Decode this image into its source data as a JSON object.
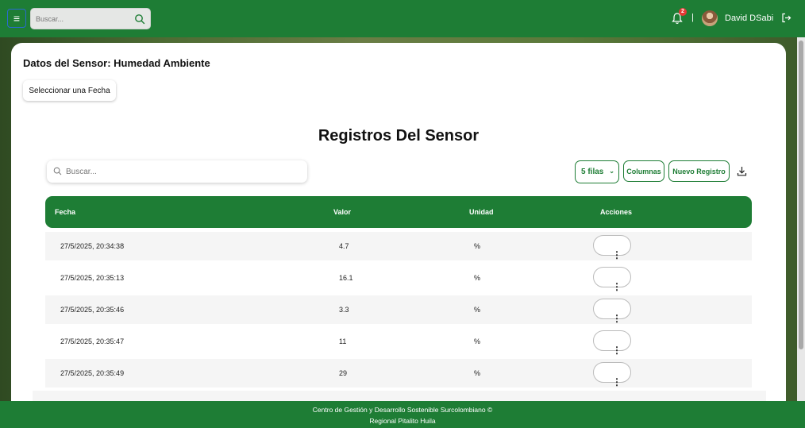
{
  "topbar": {
    "menu_icon": "hamburger-icon",
    "search_placeholder": "Buscar...",
    "notification_count": "2",
    "separator": "|",
    "user_name": "David DSabi",
    "brand_color": "#1e7d35"
  },
  "card": {
    "title": "Datos del Sensor: Humedad Ambiente",
    "date_button": "Seleccionar una Fecha",
    "table_title": "Registros Del Sensor"
  },
  "toolbar": {
    "search_placeholder": "Buscar...",
    "rows_label": "5 filas",
    "columns_label": "Columnas",
    "new_record_label": "Nuevo Registro"
  },
  "table": {
    "headers": {
      "fecha": "Fecha",
      "valor": "Valor",
      "unidad": "Unidad",
      "acciones": "Acciones"
    },
    "rows": [
      {
        "fecha": "27/5/2025, 20:34:38",
        "valor": "4.7",
        "unidad": "%",
        "accion": "⋮"
      },
      {
        "fecha": "27/5/2025, 20:35:13",
        "valor": "16.1",
        "unidad": "%",
        "accion": "⋮"
      },
      {
        "fecha": "27/5/2025, 20:35:46",
        "valor": "3.3",
        "unidad": "%",
        "accion": "⋮"
      },
      {
        "fecha": "27/5/2025, 20:35:47",
        "valor": "11",
        "unidad": "%",
        "accion": "⋮"
      },
      {
        "fecha": "27/5/2025, 20:35:49",
        "valor": "29",
        "unidad": "%",
        "accion": "⋮"
      }
    ]
  },
  "footer": {
    "line1": "Centro de Gestión y Desarrollo Sostenible Surcolombiano ©",
    "line2": "Regional Pitalito Huila"
  }
}
